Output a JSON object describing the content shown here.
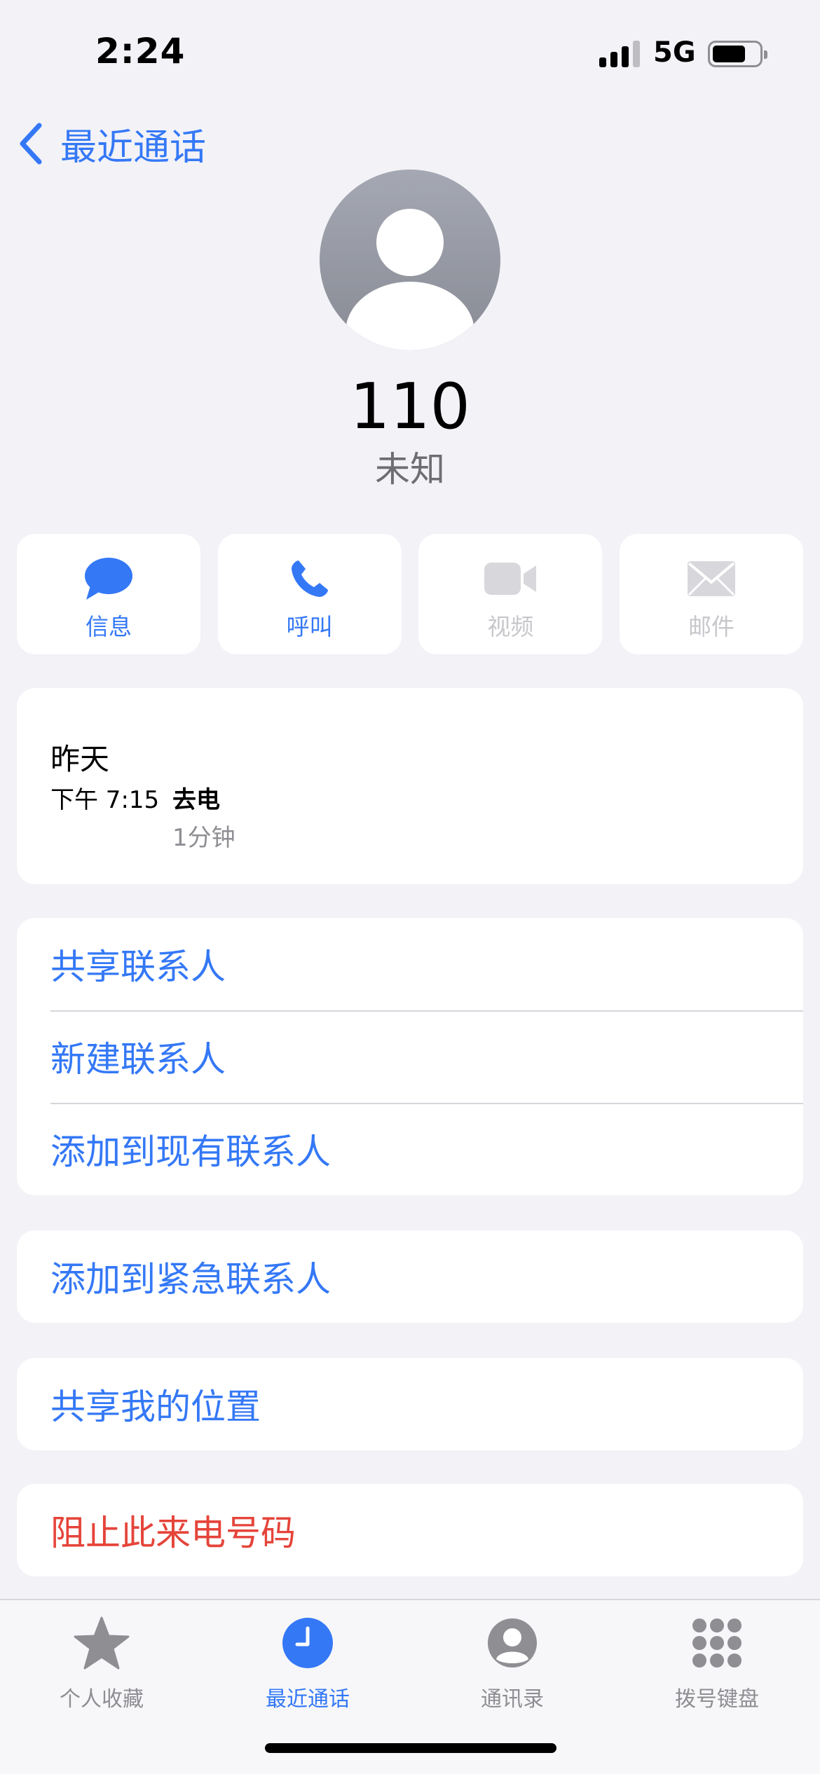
{
  "status_bar": {
    "time": "2:24",
    "network": "5G",
    "battery_level": 0.7,
    "signal_bars": 3
  },
  "nav": {
    "back_label": "最近通话"
  },
  "contact": {
    "number": "110",
    "label": "未知"
  },
  "actions": [
    {
      "label": "信息",
      "icon": "message-bubble-icon",
      "enabled": true
    },
    {
      "label": "呼叫",
      "icon": "phone-icon",
      "enabled": true
    },
    {
      "label": "视频",
      "icon": "video-camera-icon",
      "enabled": false
    },
    {
      "label": "邮件",
      "icon": "envelope-icon",
      "enabled": false
    }
  ],
  "history": {
    "day": "昨天",
    "time": "下午 7:15",
    "type": "去电",
    "duration": "1分钟"
  },
  "options": {
    "share_contact": "共享联系人",
    "new_contact": "新建联系人",
    "add_existing": "添加到现有联系人",
    "add_emergency": "添加到紧急联系人",
    "share_location": "共享我的位置",
    "block_caller": "阻止此来电号码"
  },
  "tabs": [
    {
      "label": "个人收藏",
      "icon": "star-icon",
      "active": false
    },
    {
      "label": "最近通话",
      "icon": "clock-icon",
      "active": true
    },
    {
      "label": "通讯录",
      "icon": "person-circle-icon",
      "active": false
    },
    {
      "label": "拨号键盘",
      "icon": "keypad-icon",
      "active": false
    }
  ],
  "colors": {
    "accent": "#3478f6",
    "destructive": "#e5443a",
    "background": "#f2f2f7",
    "disabled": "#c7c7cc"
  }
}
